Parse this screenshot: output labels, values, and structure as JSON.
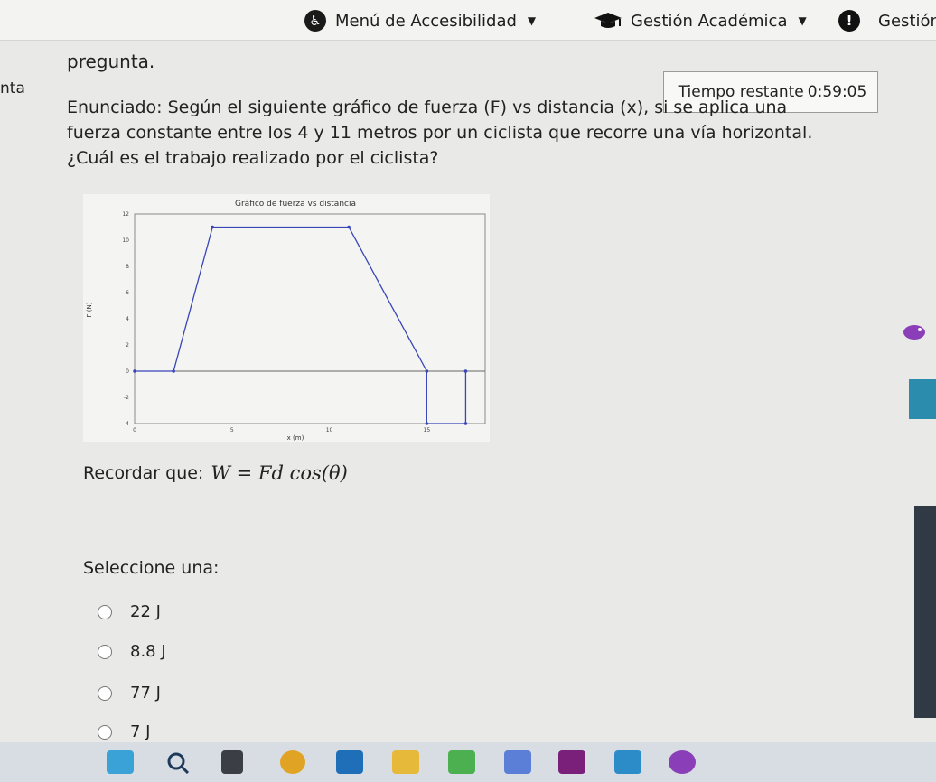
{
  "nav": {
    "accessibility": "Menú de Accesibilidad",
    "academic": "Gestión Académica",
    "management": "Gestión"
  },
  "side_label": "nta",
  "question": {
    "heading": "pregunta.",
    "timer_label": "Tiempo restante",
    "timer_value": "0:59:05",
    "statement": "Enunciado: Según el siguiente gráfico de fuerza (F) vs distancia (x), si se aplica una fuerza constante entre los 4 y 11 metros por un ciclista que recorre una vía horizontal. ¿Cuál es el trabajo realizado por el ciclista?",
    "reminder_label": "Recordar que:",
    "reminder_formula": "W = Fd cos(θ)",
    "select_label": "Seleccione una:",
    "options": [
      "22 J",
      "8.8 J",
      "77 J",
      "7 J"
    ]
  },
  "chart_data": {
    "type": "line",
    "title": "Gráfico de fuerza vs distancia",
    "xlabel": "x (m)",
    "ylabel": "F (N)",
    "xlim": [
      0,
      18
    ],
    "ylim": [
      -4,
      12
    ],
    "xticks": [
      "0",
      "5",
      "10",
      "15"
    ],
    "yticks": [
      "12",
      "10",
      "8",
      "6",
      "4",
      "2",
      "0",
      "-2",
      "-4"
    ],
    "series": [
      {
        "x": [
          0,
          2,
          4,
          11,
          15,
          15,
          17,
          17
        ],
        "y": [
          0,
          0,
          11,
          11,
          0,
          -4,
          -4,
          0
        ]
      }
    ],
    "color": "#3846b8"
  },
  "taskbar": {
    "icons": [
      "start-icon",
      "search-icon",
      "file-explorer-icon",
      "chrome-icon",
      "calendar-icon",
      "folder-icon",
      "teams-icon",
      "app-icon",
      "onenote-icon",
      "photos-icon",
      "game-icon"
    ]
  }
}
